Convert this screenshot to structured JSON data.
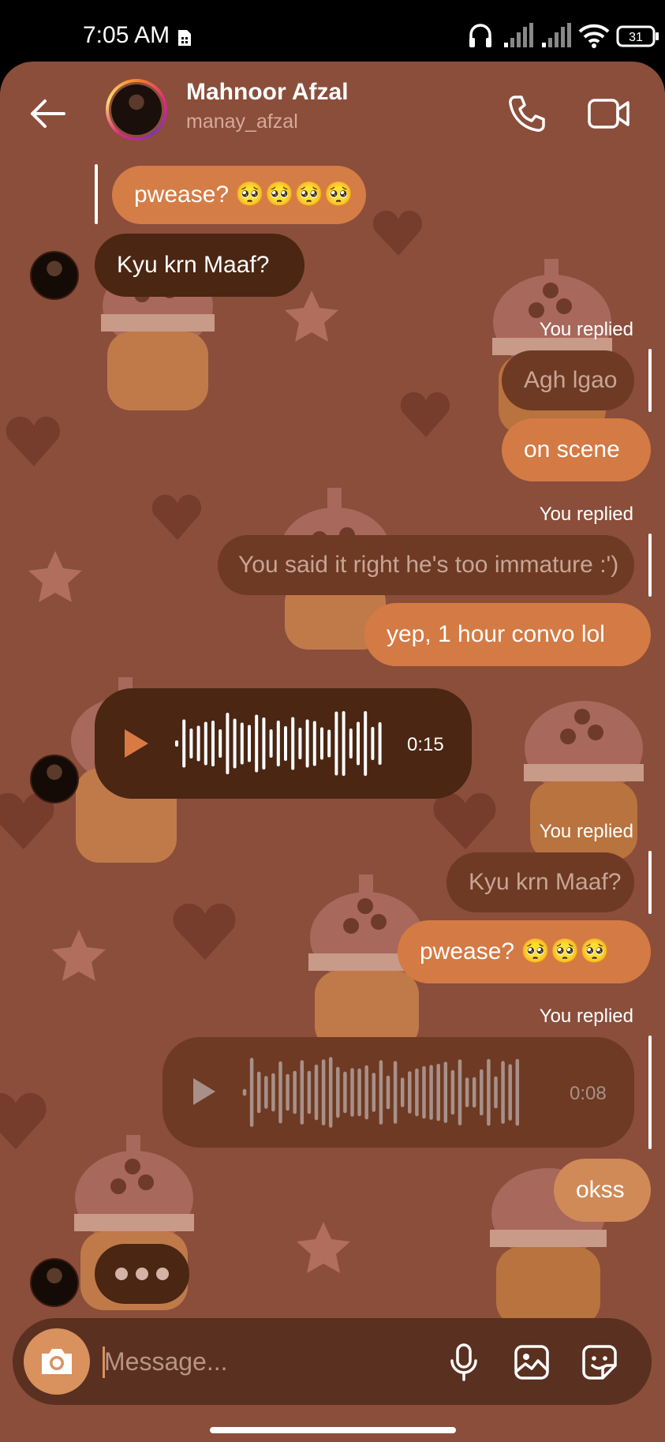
{
  "status_bar": {
    "time": "7:05 AM",
    "battery": "31",
    "icons": [
      "sim-icon",
      "headphones-icon",
      "signal-icon",
      "signal-icon",
      "wifi-icon",
      "battery-icon"
    ]
  },
  "header": {
    "contact_name": "Mahnoor Afzal",
    "contact_handle": "manay_afzal",
    "icons": [
      "back-arrow-icon",
      "phone-icon",
      "video-camera-icon"
    ]
  },
  "messages": {
    "m1": "pwease? 🥺🥺🥺🥺",
    "m2": "Kyu krn Maaf?",
    "you_replied_1": "You replied",
    "m3_quote": "Agh lgao",
    "m4": "on scene",
    "you_replied_2": "You replied",
    "m5_quote": "You said it right he's too immature :')",
    "m6": "yep, 1 hour convo lol",
    "voice1_duration": "0:15",
    "you_replied_3": "You replied",
    "m7_quote": "Kyu krn Maaf?",
    "m8": "pwease? 🥺🥺🥺",
    "you_replied_4": "You replied",
    "voice2_duration": "0:08",
    "m9": "okss"
  },
  "composer": {
    "placeholder": "Message...",
    "icons": [
      "camera-icon",
      "microphone-icon",
      "gallery-icon",
      "sticker-icon"
    ]
  },
  "colors": {
    "chat_bg": "#8a4e3b",
    "received_bubble": "#4a2613",
    "sent_bubble": "#d47a44",
    "quote_bubble": "#6e3a23"
  }
}
